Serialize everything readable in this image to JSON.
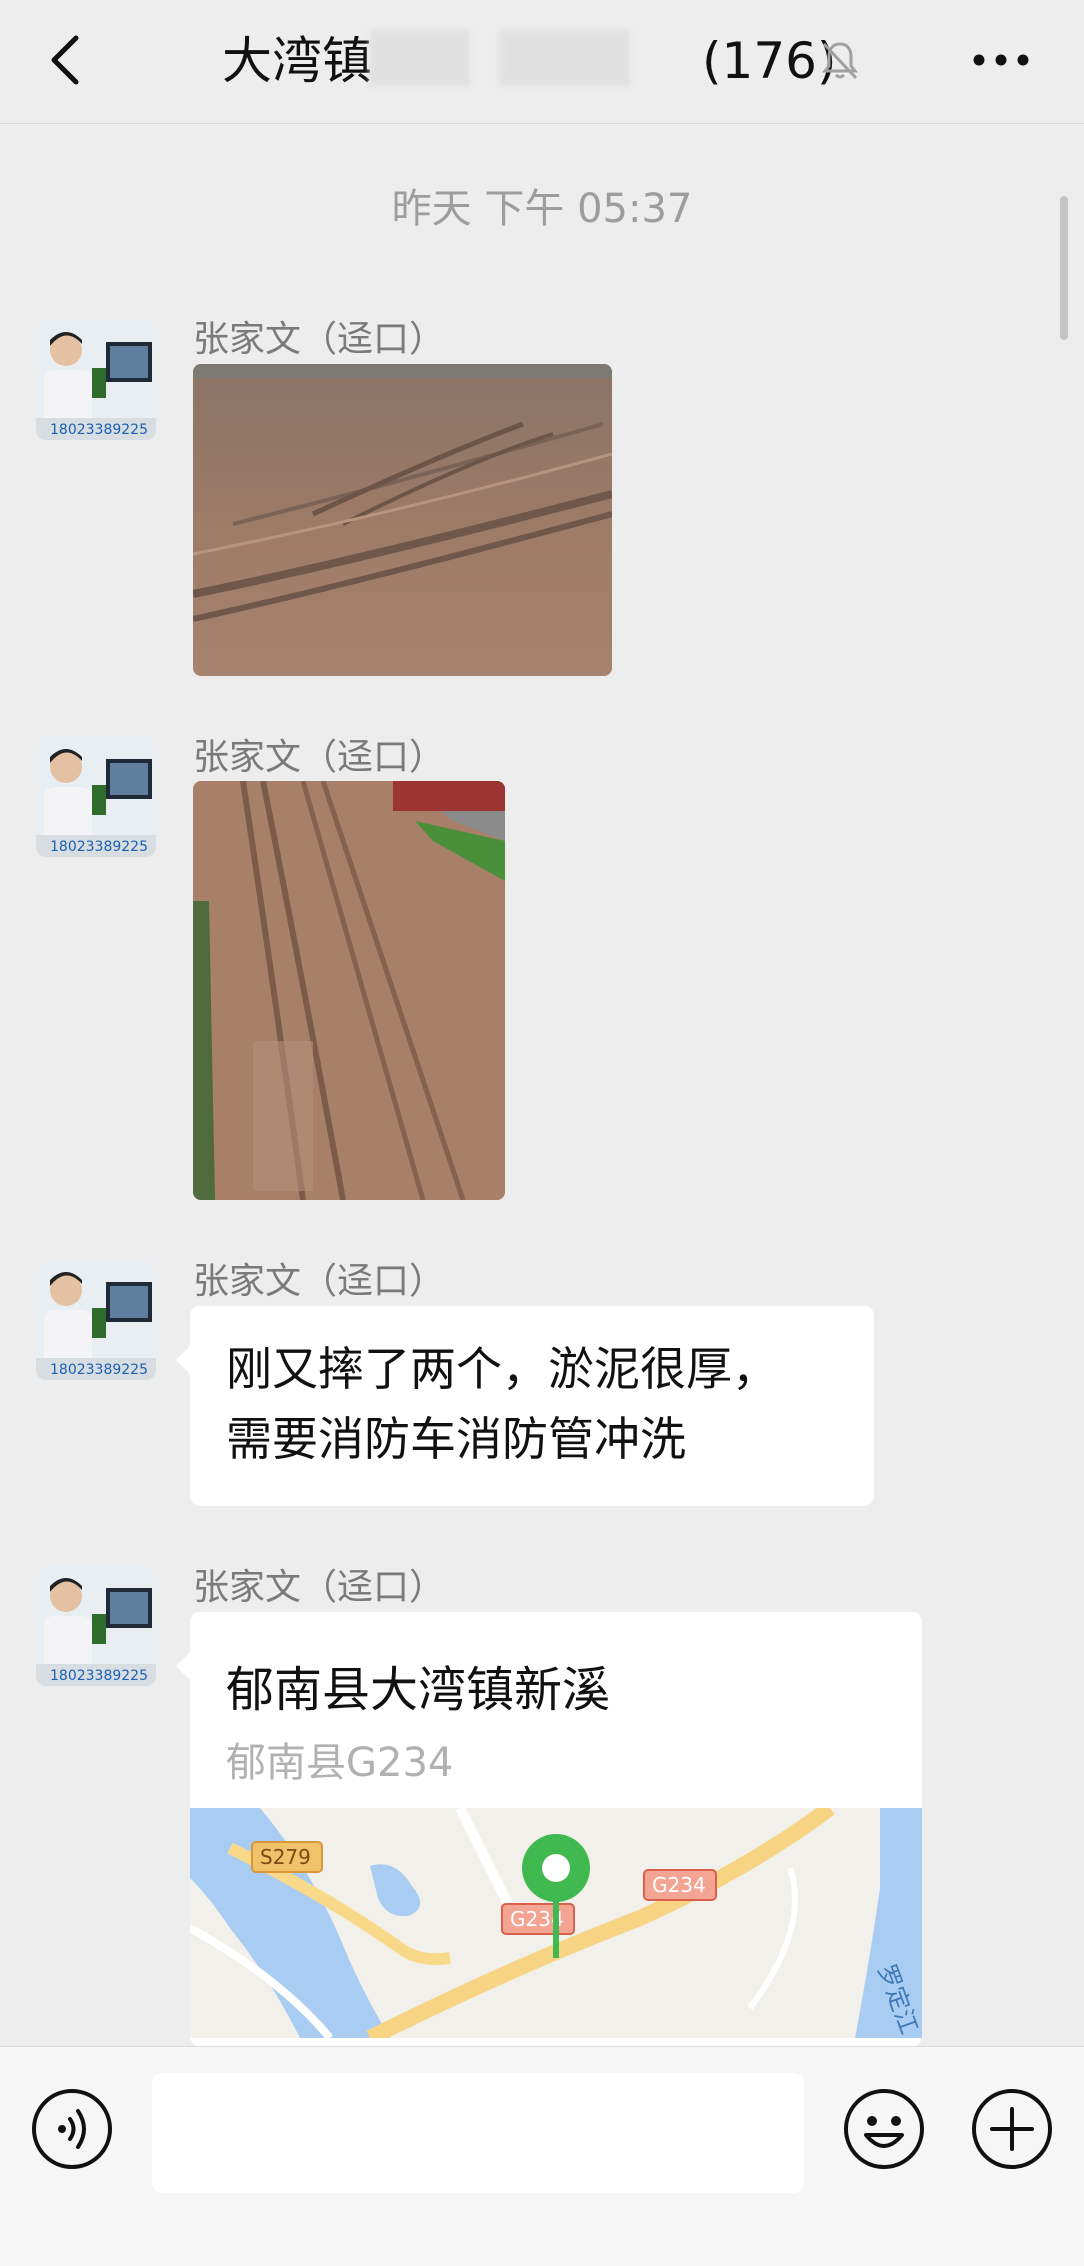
{
  "header": {
    "title_left": "大湾镇",
    "title_right": "(176)",
    "back_icon": "chevron-left-icon",
    "mute_icon": "bell-off-icon",
    "more_icon": "more-icon"
  },
  "chat": {
    "timestamp": "昨天 下午 05:37",
    "messages": [
      {
        "sender": "张家文（迳口）",
        "type": "image",
        "image": "muddy-road-photo"
      },
      {
        "sender": "张家文（迳口）",
        "type": "image",
        "image": "muddy-road-tracks-photo"
      },
      {
        "sender": "张家文（迳口）",
        "type": "text",
        "lines": [
          "刚又摔了两个，淤泥很厚，",
          "需要消防车消防管冲洗"
        ]
      },
      {
        "sender": "张家文（迳口）",
        "type": "location",
        "title": "郁南县大湾镇新溪",
        "subtitle": "郁南县G234",
        "map_labels": {
          "road1": "S279",
          "road2": "G234",
          "road3": "G234",
          "river": "罗定江"
        }
      }
    ],
    "avatar_caption": "18023389225"
  },
  "input_bar": {
    "voice_icon": "voice-icon",
    "emoji_icon": "emoji-icon",
    "plus_icon": "plus-icon",
    "input_value": ""
  },
  "colors": {
    "background": "#ededed",
    "bubble": "#ffffff",
    "map_pin": "#3fb950",
    "road_label": "#e8b04a"
  }
}
